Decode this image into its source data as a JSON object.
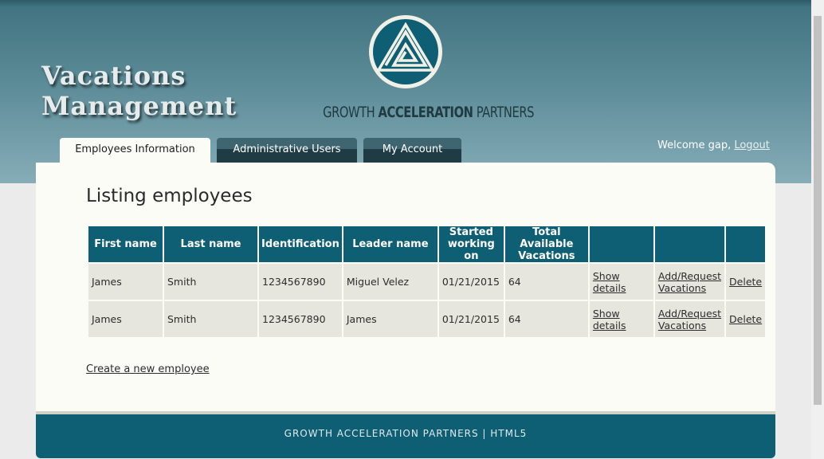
{
  "header": {
    "title_line1": "Vacations",
    "title_line2": "Management",
    "company": {
      "part1": "GROWTH ",
      "part2": "ACCELERATION",
      "part3": " PARTNERS"
    },
    "logo_icon": "triangle-spiral-logo-icon"
  },
  "nav": {
    "tabs": [
      {
        "label": "Employees Information",
        "active": true
      },
      {
        "label": "Administrative Users",
        "active": false
      },
      {
        "label": "My Account",
        "active": false
      }
    ]
  },
  "user": {
    "welcome": "Welcome gap,",
    "logout": "Logout"
  },
  "main": {
    "heading": "Listing employees",
    "columns": [
      "First name",
      "Last name",
      "Identification",
      "Leader name",
      "Started working on",
      "Total Available Vacations",
      "",
      "",
      ""
    ],
    "rows": [
      {
        "first_name": "James",
        "last_name": "Smith",
        "identification": "1234567890",
        "leader": "Miguel Velez",
        "started": "01/21/2015",
        "vacations": "64",
        "show_details": "Show details",
        "add_request": "Add/Request Vacations",
        "delete": "Delete"
      },
      {
        "first_name": "James",
        "last_name": "Smith",
        "identification": "1234567890",
        "leader": "James",
        "started": "01/21/2015",
        "vacations": "64",
        "show_details": "Show details",
        "add_request": "Add/Request Vacations",
        "delete": "Delete"
      }
    ],
    "create_link": "Create a new employee"
  },
  "footer": {
    "text": "GROWTH ACCELERATION PARTNERS | HTML5"
  },
  "colors": {
    "brand_teal": "#0f5f74",
    "header_gradient_top": "#3f727f",
    "header_gradient_bottom": "#86adb8",
    "content_bg": "#fbfcf6",
    "row_bg": "#e6e6de"
  }
}
